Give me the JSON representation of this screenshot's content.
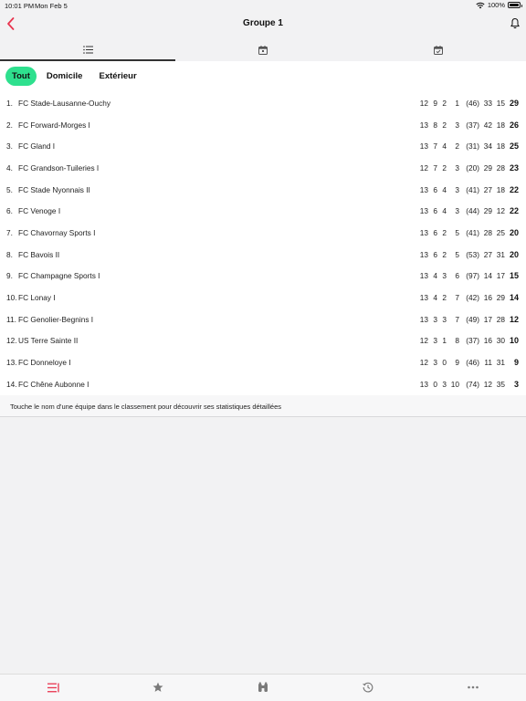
{
  "status": {
    "time": "10:01 PM",
    "date": "Mon Feb 5",
    "battery": "100%",
    "battery_level": 1.0
  },
  "nav": {
    "title": "Groupe 1"
  },
  "filters": [
    {
      "label": "Tout",
      "active": true
    },
    {
      "label": "Domicile",
      "active": false
    },
    {
      "label": "Extérieur",
      "active": false
    }
  ],
  "standings": [
    {
      "rank": "1.",
      "team": "FC Stade-Lausanne-Ouchy",
      "played": "12",
      "won": "9",
      "drawn": "2",
      "lost": "1",
      "gd": "(46)",
      "gf": "33",
      "ga": "15",
      "pts": "29"
    },
    {
      "rank": "2.",
      "team": "FC Forward-Morges I",
      "played": "13",
      "won": "8",
      "drawn": "2",
      "lost": "3",
      "gd": "(37)",
      "gf": "42",
      "ga": "18",
      "pts": "26"
    },
    {
      "rank": "3.",
      "team": "FC Gland I",
      "played": "13",
      "won": "7",
      "drawn": "4",
      "lost": "2",
      "gd": "(31)",
      "gf": "34",
      "ga": "18",
      "pts": "25"
    },
    {
      "rank": "4.",
      "team": "FC Grandson-Tuileries I",
      "played": "12",
      "won": "7",
      "drawn": "2",
      "lost": "3",
      "gd": "(20)",
      "gf": "29",
      "ga": "28",
      "pts": "23"
    },
    {
      "rank": "5.",
      "team": "FC Stade Nyonnais II",
      "played": "13",
      "won": "6",
      "drawn": "4",
      "lost": "3",
      "gd": "(41)",
      "gf": "27",
      "ga": "18",
      "pts": "22"
    },
    {
      "rank": "6.",
      "team": "FC Venoge I",
      "played": "13",
      "won": "6",
      "drawn": "4",
      "lost": "3",
      "gd": "(44)",
      "gf": "29",
      "ga": "12",
      "pts": "22"
    },
    {
      "rank": "7.",
      "team": "FC Chavornay Sports I",
      "played": "13",
      "won": "6",
      "drawn": "2",
      "lost": "5",
      "gd": "(41)",
      "gf": "28",
      "ga": "25",
      "pts": "20"
    },
    {
      "rank": "8.",
      "team": "FC Bavois II",
      "played": "13",
      "won": "6",
      "drawn": "2",
      "lost": "5",
      "gd": "(53)",
      "gf": "27",
      "ga": "31",
      "pts": "20"
    },
    {
      "rank": "9.",
      "team": "FC Champagne Sports I",
      "played": "13",
      "won": "4",
      "drawn": "3",
      "lost": "6",
      "gd": "(97)",
      "gf": "14",
      "ga": "17",
      "pts": "15"
    },
    {
      "rank": "10.",
      "team": "FC Lonay I",
      "played": "13",
      "won": "4",
      "drawn": "2",
      "lost": "7",
      "gd": "(42)",
      "gf": "16",
      "ga": "29",
      "pts": "14"
    },
    {
      "rank": "11.",
      "team": "FC Genolier-Begnins I",
      "played": "13",
      "won": "3",
      "drawn": "3",
      "lost": "7",
      "gd": "(49)",
      "gf": "17",
      "ga": "28",
      "pts": "12"
    },
    {
      "rank": "12.",
      "team": "US Terre Sainte II",
      "played": "12",
      "won": "3",
      "drawn": "1",
      "lost": "8",
      "gd": "(37)",
      "gf": "16",
      "ga": "30",
      "pts": "10"
    },
    {
      "rank": "13.",
      "team": "FC Donneloye I",
      "played": "12",
      "won": "3",
      "drawn": "0",
      "lost": "9",
      "gd": "(46)",
      "gf": "11",
      "ga": "31",
      "pts": "9"
    },
    {
      "rank": "14.",
      "team": "FC Chêne Aubonne I",
      "played": "13",
      "won": "0",
      "drawn": "3",
      "lost": "10",
      "gd": "(74)",
      "gf": "12",
      "ga": "35",
      "pts": "3"
    }
  ],
  "hint": "Touche le nom d'une équipe dans le classement pour découvrir ses statistiques détaillées",
  "colors": {
    "accent": "#e8344e",
    "chip_active": "#2ee08e"
  },
  "icons": {
    "top_tabs": [
      "list-icon",
      "calendar-icon",
      "calendar-check-icon"
    ],
    "bottom_tabs": [
      "standings-icon",
      "star-icon",
      "binoculars-icon",
      "history-icon",
      "more-icon"
    ]
  }
}
